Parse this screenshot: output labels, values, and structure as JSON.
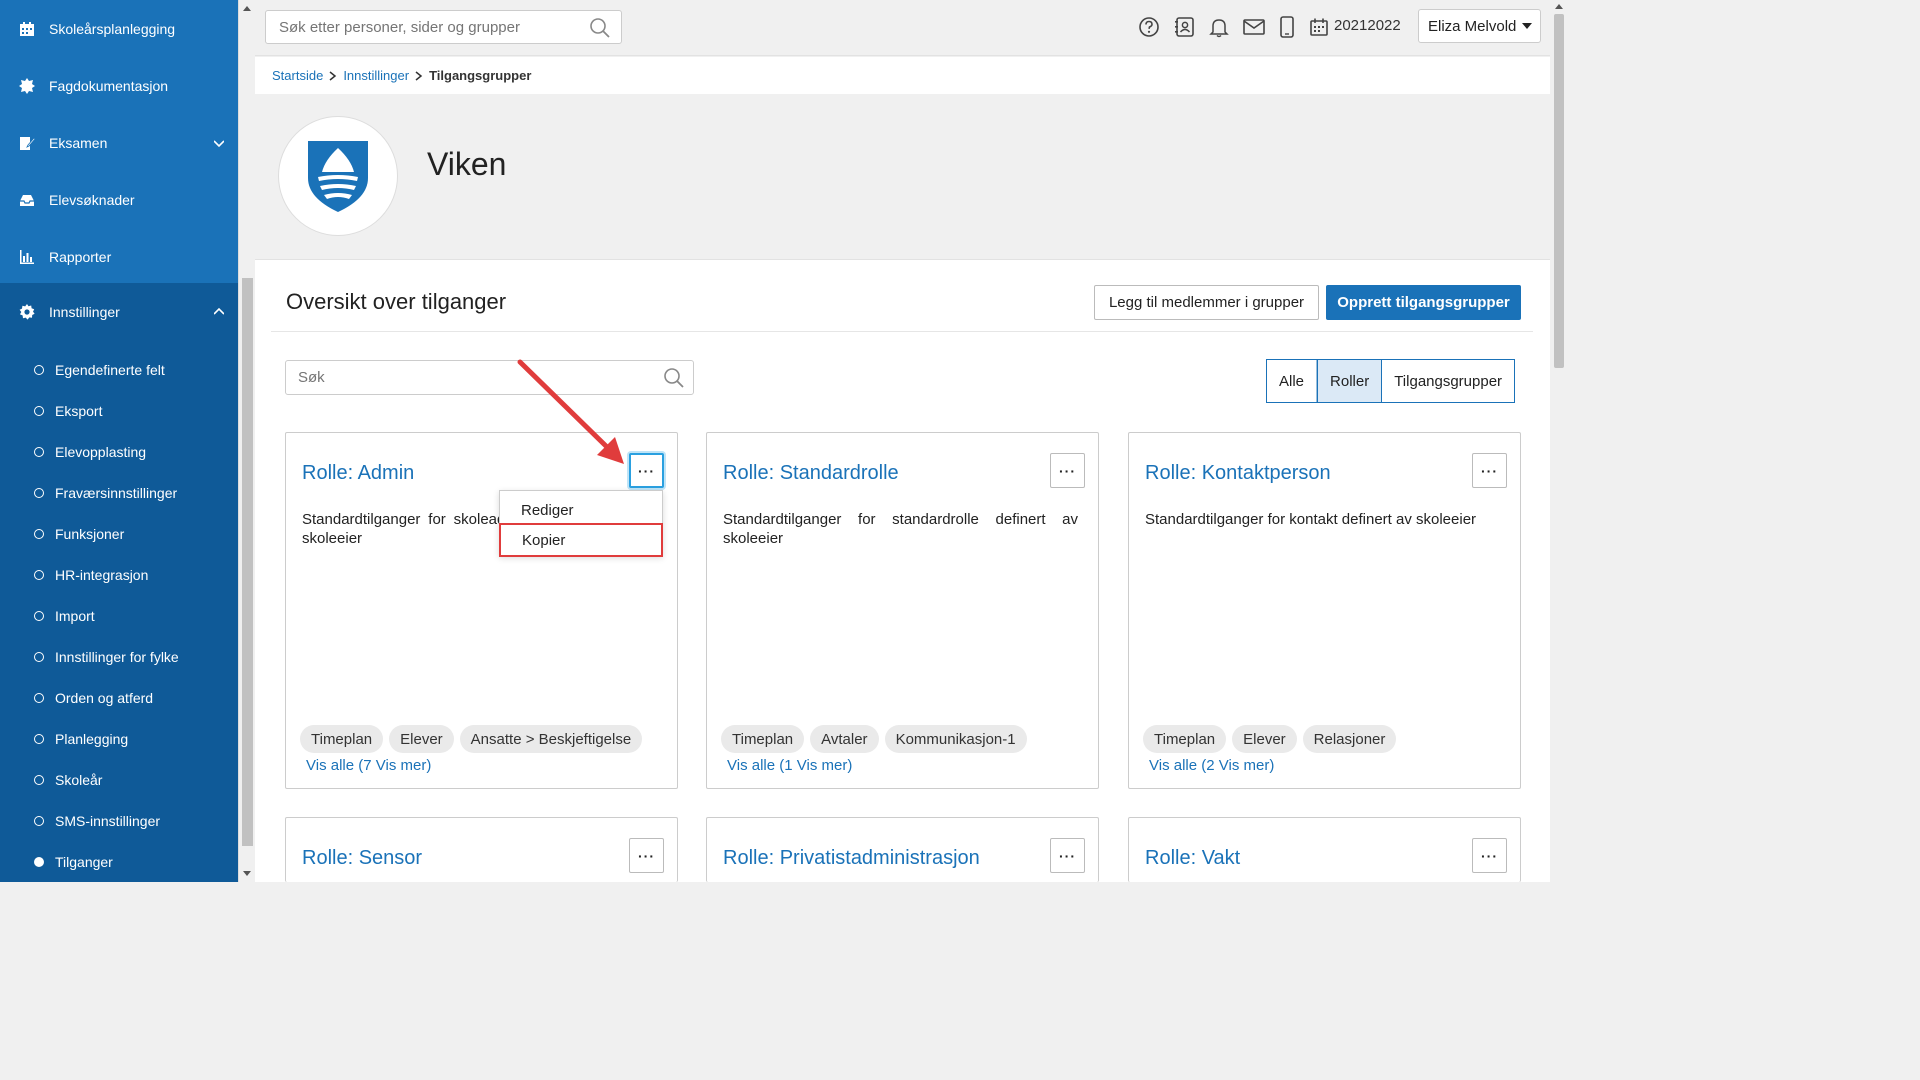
{
  "sidebar": {
    "items": [
      {
        "label": "Skoleårsplanlegging",
        "icon": "calendar-icon"
      },
      {
        "label": "Fagdokumentasjon",
        "icon": "gear-badge-icon"
      },
      {
        "label": "Eksamen",
        "icon": "edit-icon"
      },
      {
        "label": "Elevsøknader",
        "icon": "inbox-icon"
      },
      {
        "label": "Rapporter",
        "icon": "bar-chart-icon"
      }
    ],
    "settings": {
      "label": "Innstillinger",
      "children": [
        "Egendefinerte felt",
        "Eksport",
        "Elevopplasting",
        "Fraværsinnstillinger",
        "Funksjoner",
        "HR-integrasjon",
        "Import",
        "Innstillinger for fylke",
        "Orden og atferd",
        "Planlegging",
        "Skoleår",
        "SMS-innstillinger",
        "Tilganger"
      ],
      "active": "Tilganger"
    }
  },
  "topbar": {
    "search_placeholder": "Søk etter personer, sider og grupper",
    "year": "20212022",
    "user": "Eliza Melvold"
  },
  "breadcrumb": {
    "home": "Startside",
    "parent": "Innstillinger",
    "current": "Tilgangsgrupper"
  },
  "header": {
    "org_name": "Viken"
  },
  "panel": {
    "title": "Oversikt over tilganger",
    "add_members_label": "Legg til medlemmer i grupper",
    "create_label": "Opprett tilgangsgrupper",
    "search_placeholder": "Søk",
    "filters": [
      "Alle",
      "Roller",
      "Tilgangsgrupper"
    ],
    "selected_filter": "Roller"
  },
  "cards": [
    {
      "title": "Rolle: Admin",
      "description": "Standardtilganger for skoleadministrator definert av skoleeier",
      "tags": [
        "Timeplan",
        "Elever",
        "Ansatte > Beskjeftigelse"
      ],
      "more": "Vis alle (7 Vis mer)"
    },
    {
      "title": "Rolle: Standardrolle",
      "description": "Standardtilganger for standardrolle definert av skoleeier",
      "tags": [
        "Timeplan",
        "Avtaler",
        "Kommunikasjon-1"
      ],
      "more": "Vis alle (1 Vis mer)"
    },
    {
      "title": "Rolle: Kontaktperson",
      "description": "Standardtilganger for kontakt definert av skoleeier",
      "tags": [
        "Timeplan",
        "Elever",
        "Relasjoner"
      ],
      "more": "Vis alle (2 Vis mer)"
    },
    {
      "title": "Rolle: Sensor"
    },
    {
      "title": "Rolle: Privatistadministrasjon"
    },
    {
      "title": "Rolle: Vakt"
    }
  ],
  "card_menu": {
    "icon": "more-horizontal-icon",
    "items": [
      "Rediger",
      "Kopier"
    ],
    "highlighted": "Kopier"
  },
  "colors": {
    "sidebar": "#1a72b8",
    "sidebar_active_block": "#0f5a98",
    "accent": "#1a72b8",
    "annotation": "#e03c3c"
  }
}
